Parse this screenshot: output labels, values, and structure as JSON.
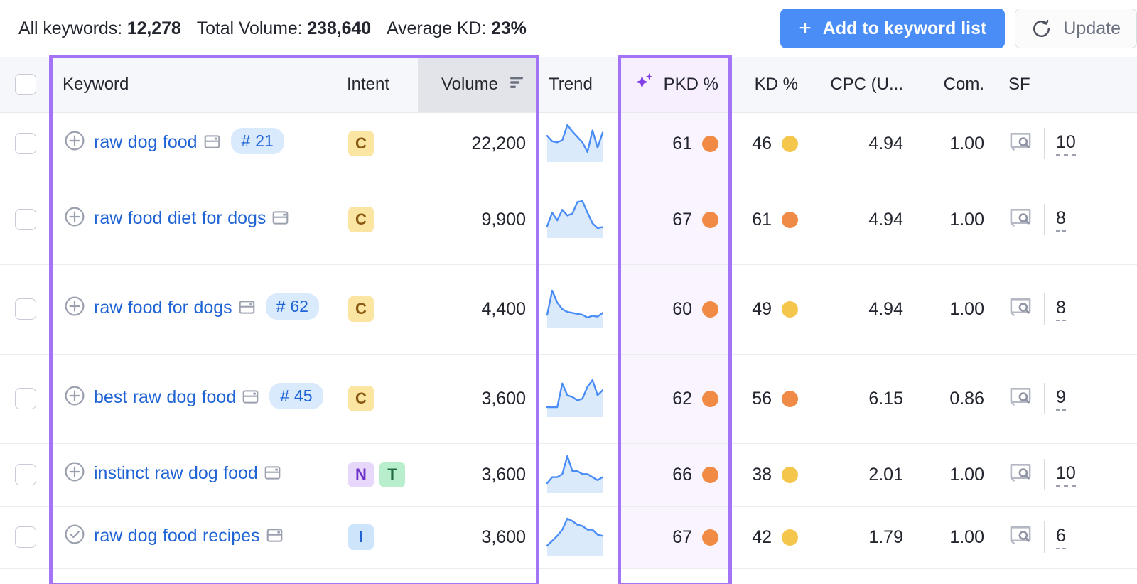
{
  "summary": {
    "stats": [
      {
        "label": "All keywords:",
        "value": "12,278"
      },
      {
        "label": "Total Volume:",
        "value": "238,640"
      },
      {
        "label": "Average KD:",
        "value": "23%"
      }
    ]
  },
  "actions": {
    "add_to_list_label": "Add to keyword list",
    "add_icon": "plus-icon",
    "update_label": "Update",
    "update_icon": "refresh-icon",
    "primary_color": "#4a8df6"
  },
  "table": {
    "columns": [
      {
        "key": "checkbox",
        "label": ""
      },
      {
        "key": "keyword",
        "label": "Keyword"
      },
      {
        "key": "intent",
        "label": "Intent"
      },
      {
        "key": "volume",
        "label": "Volume",
        "sorted": true,
        "sort_icon": "sort-descending-icon"
      },
      {
        "key": "trend",
        "label": "Trend"
      },
      {
        "key": "pkd",
        "label": "PKD %",
        "icon": "sparkle-icon"
      },
      {
        "key": "kd",
        "label": "KD %"
      },
      {
        "key": "cpc",
        "label": "CPC (U..."
      },
      {
        "key": "com",
        "label": "Com."
      },
      {
        "key": "sf",
        "label": "SF"
      }
    ],
    "rows": [
      {
        "state_icon": "plus-circle-icon",
        "keyword": "raw dog food",
        "serp_icon": "serp-features-icon",
        "position_badge": "# 21",
        "intents": [
          "C"
        ],
        "volume": "22,200",
        "trend": [
          52,
          42,
          40,
          44,
          72,
          60,
          50,
          40,
          22,
          62,
          30,
          58
        ],
        "pkd": "61",
        "pkd_color": "#f08a44",
        "kd": "46",
        "kd_color": "#f6c council",
        "cpc": "4.94",
        "com": "1.00",
        "sf_icon": "serp-preview-icon",
        "sf": "10"
      },
      {
        "state_icon": "plus-circle-icon",
        "keyword": "raw food diet for dogs",
        "serp_icon": "serp-features-icon",
        "position_badge": "",
        "intents": [
          "C"
        ],
        "volume": "9,900",
        "trend": [
          24,
          52,
          36,
          58,
          46,
          50,
          74,
          76,
          52,
          30,
          20,
          22
        ],
        "pkd": "67",
        "pkd_color": "#f08a44",
        "kd": "61",
        "kd_color": "#f08a44",
        "cpc": "4.94",
        "com": "1.00",
        "sf_icon": "serp-preview-icon",
        "sf": "8"
      },
      {
        "state_icon": "plus-circle-icon",
        "keyword": "raw food for dogs",
        "serp_icon": "serp-features-icon",
        "position_badge": "# 62",
        "intents": [
          "C"
        ],
        "volume": "4,400",
        "trend": [
          24,
          76,
          50,
          36,
          30,
          28,
          26,
          24,
          18,
          22,
          20,
          28
        ],
        "pkd": "60",
        "pkd_color": "#f08a44",
        "kd": "49",
        "kd_color": "#f5c64c",
        "cpc": "4.94",
        "com": "1.00",
        "sf_icon": "serp-preview-icon",
        "sf": "8"
      },
      {
        "state_icon": "plus-circle-icon",
        "keyword": "best raw dog food",
        "serp_icon": "serp-features-icon",
        "position_badge": "# 45",
        "intents": [
          "C"
        ],
        "volume": "3,600",
        "trend": [
          30,
          30,
          30,
          58,
          44,
          42,
          38,
          40,
          54,
          62,
          44,
          50
        ],
        "pkd": "62",
        "pkd_color": "#f08a44",
        "kd": "56",
        "kd_color": "#f08a44",
        "cpc": "6.15",
        "com": "0.86",
        "sf_icon": "serp-preview-icon",
        "sf": "9"
      },
      {
        "state_icon": "plus-circle-icon",
        "keyword": "instinct raw dog food",
        "serp_icon": "serp-features-icon",
        "position_badge": "",
        "intents": [
          "N",
          "T"
        ],
        "volume": "3,600",
        "trend": [
          26,
          30,
          30,
          32,
          44,
          34,
          34,
          32,
          32,
          30,
          28,
          30
        ],
        "pkd": "66",
        "pkd_color": "#f08a44",
        "kd": "38",
        "kd_color": "#f5c64c",
        "cpc": "2.01",
        "com": "1.00",
        "sf_icon": "serp-preview-icon",
        "sf": "10"
      },
      {
        "state_icon": "check-circle-icon",
        "keyword": "raw dog food recipes",
        "serp_icon": "serp-features-icon",
        "position_badge": "",
        "intents": [
          "I"
        ],
        "volume": "3,600",
        "trend": [
          18,
          26,
          34,
          44,
          62,
          58,
          52,
          50,
          44,
          44,
          36,
          34
        ],
        "pkd": "67",
        "pkd_color": "#f08a44",
        "kd": "42",
        "kd_color": "#f5c64c",
        "cpc": "1.79",
        "com": "1.00",
        "sf_icon": "serp-preview-icon",
        "sf": "6"
      }
    ]
  },
  "highlights": {
    "left_group": "keyword-intent-volume-columns",
    "pkd_group": "pkd-column",
    "color": "#a374f5"
  }
}
